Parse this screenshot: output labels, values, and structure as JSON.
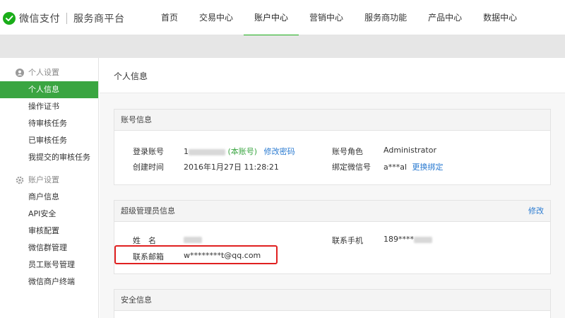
{
  "header": {
    "brand": "微信支付",
    "platform": "服务商平台",
    "nav": [
      "首页",
      "交易中心",
      "账户中心",
      "营销中心",
      "服务商功能",
      "产品中心",
      "数据中心"
    ],
    "active_nav": "账户中心"
  },
  "sidebar": {
    "groups": [
      {
        "title": "个人设置",
        "icon": "user-icon",
        "items": [
          "个人信息",
          "操作证书",
          "待审核任务",
          "已审核任务",
          "我提交的审核任务"
        ]
      },
      {
        "title": "账户设置",
        "icon": "gear-icon",
        "items": [
          "商户信息",
          "API安全",
          "审核配置",
          "微信群管理",
          "员工账号管理",
          "微信商户终端"
        ]
      }
    ],
    "active_item": "个人信息"
  },
  "page": {
    "title": "个人信息"
  },
  "account_info": {
    "title": "账号信息",
    "login_label": "登录账号",
    "login_value_prefix": "1",
    "this_account": "(本账号)",
    "change_password": "修改密码",
    "created_label": "创建时间",
    "created_value": "2016年1月27日 11:28:21",
    "role_label": "账号角色",
    "role_value": "Administrator",
    "wechat_label": "绑定微信号",
    "wechat_value": "a***al",
    "rebind": "更换绑定"
  },
  "admin_info": {
    "title": "超级管理员信息",
    "edit": "修改",
    "name_label": "姓　名",
    "phone_label": "联系手机",
    "phone_value": "189****",
    "email_label": "联系邮箱",
    "email_value": "w********t@qq.com"
  },
  "security_info": {
    "title": "安全信息"
  },
  "colors": {
    "brand_green": "#1aad19",
    "active_green": "#3aa541",
    "link_blue": "#2b7bd1",
    "highlight_red": "#e02020"
  }
}
